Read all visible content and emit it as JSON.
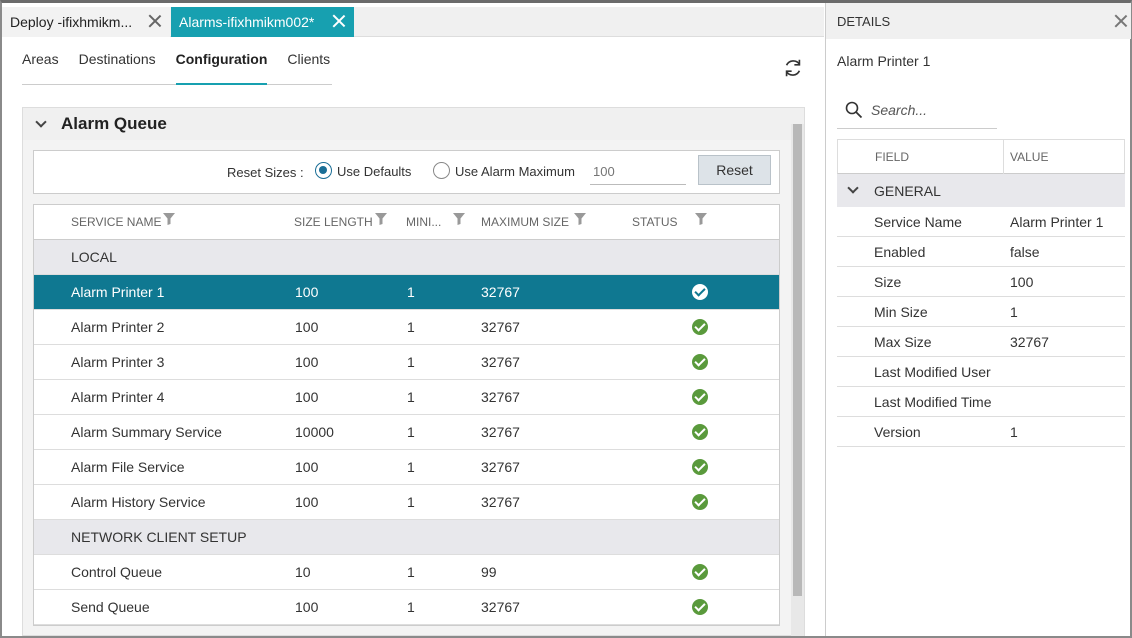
{
  "tabs": [
    {
      "label": "Deploy -ifixhmikm...",
      "active": false
    },
    {
      "label": "Alarms-ifixhmikm002*",
      "active": true
    }
  ],
  "subtabs": [
    "Areas",
    "Destinations",
    "Configuration",
    "Clients"
  ],
  "active_subtab": "Configuration",
  "queue": {
    "title": "Alarm Queue",
    "reset_sizes_label": "Reset Sizes :",
    "use_defaults_label": "Use Defaults",
    "use_alarm_max_label": "Use Alarm Maximum",
    "selected_option": "Use Defaults",
    "size_input_placeholder": "100",
    "reset_button": "Reset",
    "columns": [
      "SERVICE NAME",
      "SIZE LENGTH",
      "MINI...",
      "MAXIMUM SIZE",
      "STATUS"
    ],
    "groups": [
      {
        "name": "LOCAL",
        "rows": [
          {
            "service": "Alarm Printer 1",
            "size": "100",
            "min": "1",
            "max": "32767",
            "status": "ok",
            "selected": true
          },
          {
            "service": "Alarm Printer 2",
            "size": "100",
            "min": "1",
            "max": "32767",
            "status": "ok"
          },
          {
            "service": "Alarm Printer 3",
            "size": "100",
            "min": "1",
            "max": "32767",
            "status": "ok"
          },
          {
            "service": "Alarm Printer 4",
            "size": "100",
            "min": "1",
            "max": "32767",
            "status": "ok"
          },
          {
            "service": "Alarm Summary Service",
            "size": "10000",
            "min": "1",
            "max": "32767",
            "status": "ok"
          },
          {
            "service": "Alarm File Service",
            "size": "100",
            "min": "1",
            "max": "32767",
            "status": "ok"
          },
          {
            "service": "Alarm History Service",
            "size": "100",
            "min": "1",
            "max": "32767",
            "status": "ok"
          }
        ]
      },
      {
        "name": "NETWORK CLIENT SETUP",
        "rows": [
          {
            "service": "Control Queue",
            "size": "10",
            "min": "1",
            "max": "99",
            "status": "ok"
          },
          {
            "service": "Send Queue",
            "size": "100",
            "min": "1",
            "max": "32767",
            "status": "ok"
          }
        ]
      }
    ]
  },
  "details": {
    "title": "DETAILS",
    "item_name": "Alarm Printer 1",
    "search_placeholder": "Search...",
    "field_header": "FIELD",
    "value_header": "VALUE",
    "group": "GENERAL",
    "rows": [
      {
        "field": "Service Name",
        "value": "Alarm Printer 1"
      },
      {
        "field": "Enabled",
        "value": "false"
      },
      {
        "field": "Size",
        "value": "100"
      },
      {
        "field": "Min Size",
        "value": "1"
      },
      {
        "field": "Max Size",
        "value": "32767"
      },
      {
        "field": "Last Modified User",
        "value": ""
      },
      {
        "field": "Last Modified Time",
        "value": ""
      },
      {
        "field": "Version",
        "value": "1"
      }
    ]
  },
  "colors": {
    "accent": "#17a0b0",
    "selected_row": "#0f7891",
    "status_ok": "#5a9a3c"
  }
}
